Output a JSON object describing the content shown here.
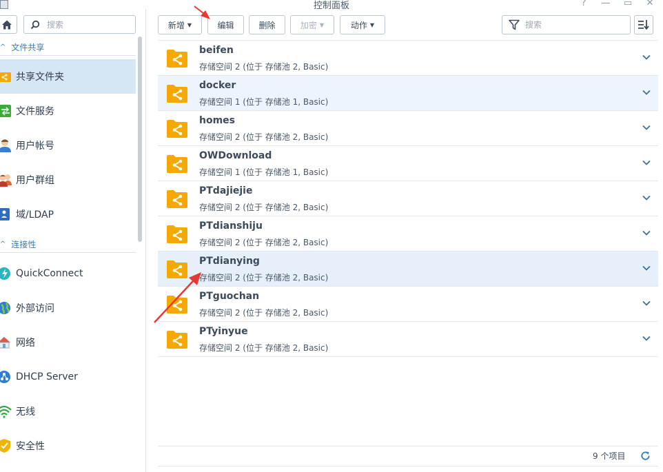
{
  "window": {
    "title": "控制面板",
    "help": "?",
    "minimize": "—",
    "maximize": "▭",
    "close": "✕"
  },
  "sidebar": {
    "search_placeholder": "搜索",
    "sections": [
      {
        "label": "文件共享"
      },
      {
        "label": "连接性"
      }
    ],
    "items": [
      {
        "label": "共享文件夹",
        "icon": "shared-folder-icon",
        "active": true
      },
      {
        "label": "文件服务",
        "icon": "file-services-icon"
      },
      {
        "label": "用户帐号",
        "icon": "user-icon"
      },
      {
        "label": "用户群组",
        "icon": "group-icon"
      },
      {
        "label": "域/LDAP",
        "icon": "ldap-icon"
      },
      {
        "label": "QuickConnect",
        "icon": "quickconnect-icon"
      },
      {
        "label": "外部访问",
        "icon": "globe-icon"
      },
      {
        "label": "网络",
        "icon": "network-icon"
      },
      {
        "label": "DHCP Server",
        "icon": "dhcp-icon"
      },
      {
        "label": "无线",
        "icon": "wifi-icon"
      },
      {
        "label": "安全性",
        "icon": "shield-icon"
      }
    ]
  },
  "toolbar": {
    "create": "新增",
    "edit": "编辑",
    "delete": "删除",
    "encrypt": "加密",
    "action": "动作",
    "filter_placeholder": "搜索"
  },
  "folders": [
    {
      "name": "beifen",
      "desc": "存储空间 2 (位于 存储池 2, Basic)"
    },
    {
      "name": "docker",
      "desc": "存储空间 1 (位于 存储池 1, Basic)"
    },
    {
      "name": "homes",
      "desc": "存储空间 2 (位于 存储池 2, Basic)"
    },
    {
      "name": "OWDownload",
      "desc": "存储空间 1 (位于 存储池 1, Basic)"
    },
    {
      "name": "PTdajiejie",
      "desc": "存储空间 2 (位于 存储池 2, Basic)"
    },
    {
      "name": "PTdianshiju",
      "desc": "存储空间 2 (位于 存储池 2, Basic)"
    },
    {
      "name": "PTdianying",
      "desc": "存储空间 2 (位于 存储池 2, Basic)"
    },
    {
      "name": "PTguochan",
      "desc": "存储空间 2 (位于 存储池 2, Basic)"
    },
    {
      "name": "PTyinyue",
      "desc": "存储空间 2 (位于 存储池 2, Basic)"
    }
  ],
  "footer": {
    "count": "9 个项目"
  },
  "colors": {
    "accent": "#2e7fb8",
    "folder": "#f5a800",
    "selected_row": "#e6f0fa",
    "active_nav": "#d7e6f5",
    "annotation_arrow": "#e53935"
  }
}
